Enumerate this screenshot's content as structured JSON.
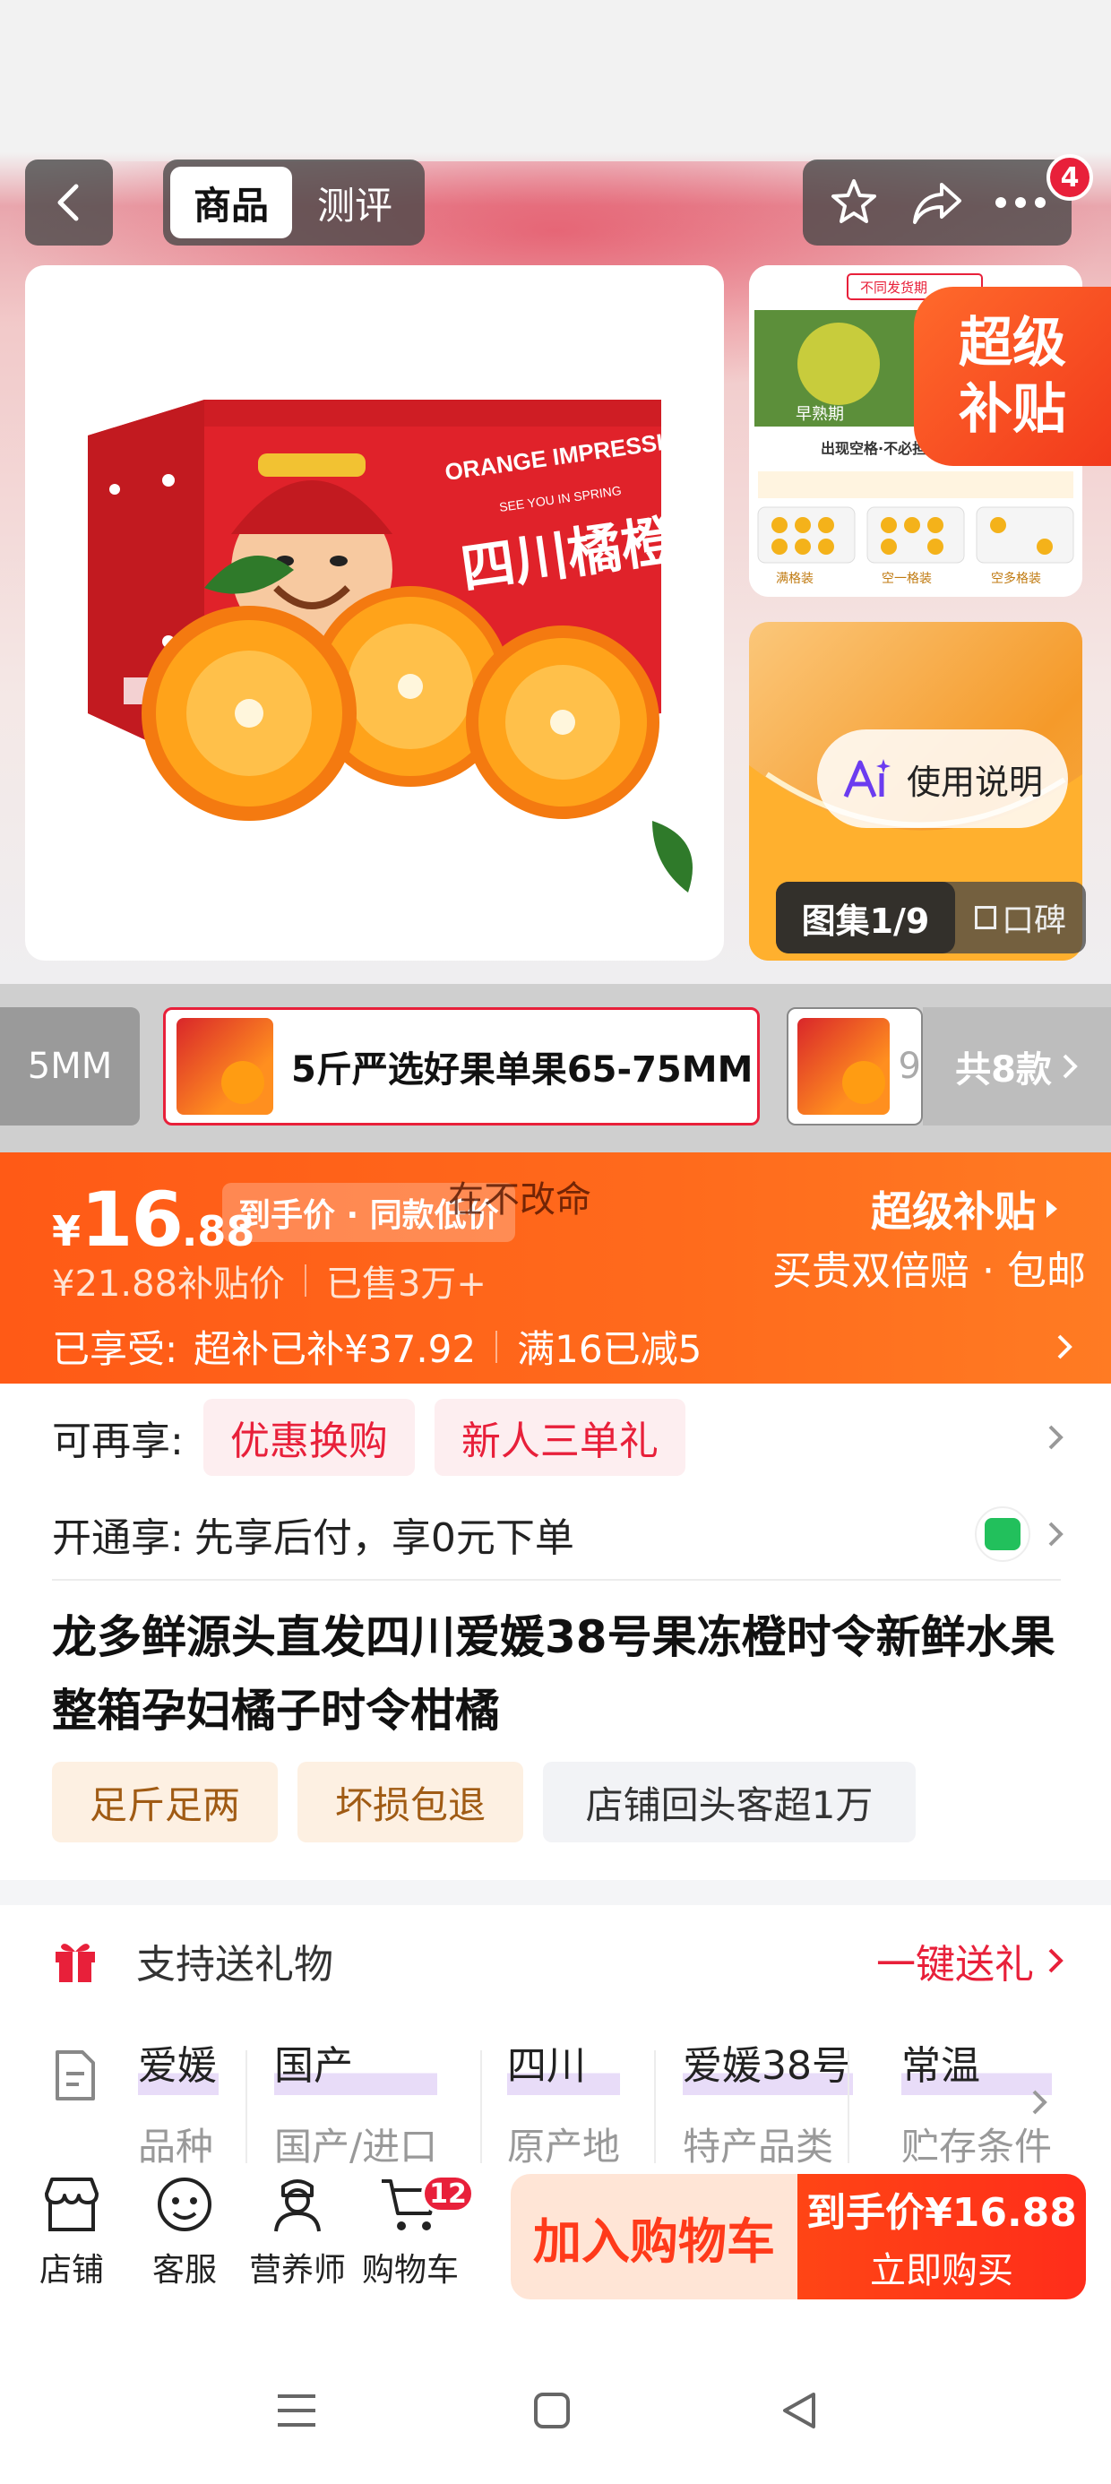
{
  "header": {
    "tabs": [
      {
        "label": "商品",
        "active": true
      },
      {
        "label": "测评",
        "active": false
      }
    ],
    "icons": [
      "back-icon",
      "star-icon",
      "share-icon",
      "more-icon"
    ],
    "more_badge": "4"
  },
  "gallery": {
    "box_brand_cn": "四川橘橙印象",
    "box_brand_en": "ORANGE IMPRESSION",
    "box_tagline": "SEE YOU IN SPRING",
    "side_top": {
      "banner": "不同发货期",
      "period": "早熟期",
      "notice": "出现空格·不必担心",
      "packs": [
        "满格装",
        "空一格装",
        "空多格装"
      ]
    },
    "super_subsidy_tag": [
      "超级",
      "补贴"
    ],
    "guide_label": "使用说明",
    "album_label": "图集1/9",
    "review_label": "口碑"
  },
  "variants": {
    "prev_label": "5MM",
    "selected_label": "5斤严选好果单果65-75MM",
    "next_label": "9",
    "total_label": "共8款"
  },
  "price": {
    "currency": "¥",
    "integer": "16",
    "decimal": ".88",
    "tag": "到手价 · 同款低价",
    "slogan": "在不改命",
    "super_link": "超级补贴",
    "super_sub": "买贵双倍赔 · 包邮",
    "original": "¥21.88补贴价",
    "sold": "已售3万+",
    "enjoyed_label": "已享受:",
    "enjoyed_1": "超补已补¥37.92",
    "enjoyed_2": "满16已减5"
  },
  "benefits": {
    "more_label": "可再享:",
    "tags": [
      "优惠换购",
      "新人三单礼"
    ],
    "open_label": "开通享:",
    "open_text": "先享后付，享0元下单"
  },
  "product": {
    "title": "龙多鲜源头直发四川爱媛38号果冻橙时令新鲜水果整箱孕妇橘子时令柑橘",
    "features": [
      "足斤足两",
      "坏损包退",
      "店铺回头客超1万"
    ]
  },
  "gift": {
    "label": "支持送礼物",
    "link": "一键送礼"
  },
  "attributes": [
    {
      "value": "爱媛",
      "key": "品种"
    },
    {
      "value": "国产",
      "key": "国产/进口"
    },
    {
      "value": "四川",
      "key": "原产地"
    },
    {
      "value": "爱媛38号",
      "key": "特产品类"
    },
    {
      "value": "常温",
      "key": "贮存条件"
    }
  ],
  "bottom": {
    "nav": [
      {
        "label": "店铺",
        "icon": "store-icon"
      },
      {
        "label": "客服",
        "icon": "service-icon"
      },
      {
        "label": "营养师",
        "icon": "nutritionist-icon"
      },
      {
        "label": "购物车",
        "icon": "cart-icon"
      }
    ],
    "cart_badge": "12",
    "add_to_cart": "加入购物车",
    "buy_price_label": "到手价¥16.88",
    "buy_now": "立即购买"
  },
  "colors": {
    "accent": "#ff5a16",
    "red": "#e8203a",
    "green": "#22c05c"
  }
}
